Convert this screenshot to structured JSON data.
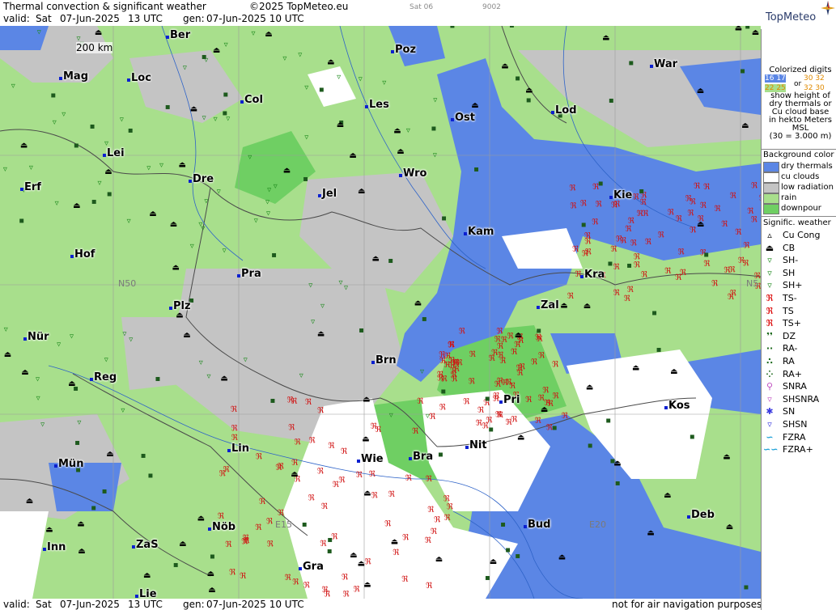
{
  "header": {
    "title": "Thermal convection & significant weather",
    "copyright": "©2025 TopMeteo.eu",
    "valid_label": "valid:",
    "valid_day": "Sat",
    "valid_date": "07-Jun-2025",
    "valid_time": "13 UTC",
    "gen_label": "gen:",
    "gen_value": "07-Jun-2025 10 UTC",
    "small_day": "Sat 06",
    "small_num": "9002"
  },
  "brand": "TopMeteo",
  "footer": {
    "valid_label": "valid:",
    "valid_day": "Sat",
    "valid_date": "07-Jun-2025",
    "valid_time": "13 UTC",
    "gen_label": "gen:",
    "gen_value": "07-Jun-2025 10 UTC",
    "disclaimer": "not for air navigation purposes"
  },
  "map": {
    "scale_label": "200 km",
    "grid_labels": [
      "N50",
      "N5",
      "E15",
      "E20"
    ],
    "cities": [
      {
        "name": "Ber"
      },
      {
        "name": "Poz"
      },
      {
        "name": "War"
      },
      {
        "name": "Mag"
      },
      {
        "name": "Loc"
      },
      {
        "name": "Col"
      },
      {
        "name": "Les"
      },
      {
        "name": "Lod"
      },
      {
        "name": "Ost"
      },
      {
        "name": "Lei"
      },
      {
        "name": "Dre"
      },
      {
        "name": "Wro"
      },
      {
        "name": "Erf"
      },
      {
        "name": "Jel"
      },
      {
        "name": "Kie"
      },
      {
        "name": "Kam"
      },
      {
        "name": "Hof"
      },
      {
        "name": "Pra"
      },
      {
        "name": "Kra"
      },
      {
        "name": "Plz"
      },
      {
        "name": "Zal"
      },
      {
        "name": "Nür"
      },
      {
        "name": "Brn"
      },
      {
        "name": "Reg"
      },
      {
        "name": "Pri"
      },
      {
        "name": "Kos"
      },
      {
        "name": "Lin"
      },
      {
        "name": "Nit"
      },
      {
        "name": "Mün"
      },
      {
        "name": "Wie"
      },
      {
        "name": "Bra"
      },
      {
        "name": "Deb"
      },
      {
        "name": "Bud"
      },
      {
        "name": "Nöb"
      },
      {
        "name": "Inn"
      },
      {
        "name": "ZaS"
      },
      {
        "name": "Gra"
      },
      {
        "name": "Lie"
      }
    ]
  },
  "legend": {
    "colorized_text": [
      "Colorized digits",
      "or",
      "show height of",
      "dry thermals or",
      "Cu cloud base",
      "in hekto Meters",
      "MSL",
      "(30 = 3.000 m)"
    ],
    "sample_digits": [
      "16 17",
      "30 32",
      "22 25",
      "32 30"
    ],
    "background_title": "Background color",
    "backgrounds": [
      {
        "label": "dry thermals",
        "color": "#5b86e5"
      },
      {
        "label": "cu clouds",
        "color": "#ffffff"
      },
      {
        "label": "low radiation",
        "color": "#c4c4c4"
      },
      {
        "label": "rain",
        "color": "#a8df8c"
      },
      {
        "label": "downpour",
        "color": "#6fcf63"
      }
    ],
    "weather_title": "Signific. weather",
    "weather": [
      {
        "label": "Cu Cong",
        "symbol": "▵",
        "color": "#000000"
      },
      {
        "label": "CB",
        "symbol": "⏏",
        "color": "#000000"
      },
      {
        "label": "SH-",
        "symbol": "▿",
        "color": "#1d8a1d"
      },
      {
        "label": "SH",
        "symbol": "▿",
        "color": "#1d8a1d"
      },
      {
        "label": "SH+",
        "symbol": "▿",
        "color": "#1d8a1d"
      },
      {
        "label": "TS-",
        "symbol": "ℜ",
        "color": "#d11"
      },
      {
        "label": "TS",
        "symbol": "ℜ",
        "color": "#d11"
      },
      {
        "label": "TS+",
        "symbol": "ℜ",
        "color": "#d11"
      },
      {
        "label": "DZ",
        "symbol": "❜❜",
        "color": "#1d6a1d"
      },
      {
        "label": "RA-",
        "symbol": "··",
        "color": "#1d6a1d"
      },
      {
        "label": "RA",
        "symbol": "∴",
        "color": "#1d6a1d"
      },
      {
        "label": "RA+",
        "symbol": "⁘",
        "color": "#1d6a1d"
      },
      {
        "label": "SNRA",
        "symbol": "⚲",
        "color": "#c04fc0"
      },
      {
        "label": "SHSNRA",
        "symbol": "▿",
        "color": "#c04fc0"
      },
      {
        "label": "SN",
        "symbol": "✱",
        "color": "#3a3adf"
      },
      {
        "label": "SHSN",
        "symbol": "▿",
        "color": "#3a3adf"
      },
      {
        "label": "FZRA",
        "symbol": "∽",
        "color": "#1aa0d8"
      },
      {
        "label": "FZRA+",
        "symbol": "∽∽",
        "color": "#1aa0d8"
      }
    ]
  },
  "colors": {
    "dry": "#5b86e5",
    "cu": "#ffffff",
    "low_radiation": "#c4c4c4",
    "rain": "#a8df8c",
    "downpour": "#6fcf63",
    "city_dot": "#0b1fd0",
    "thunder": "#d11111",
    "shower": "#1d8a1d"
  }
}
